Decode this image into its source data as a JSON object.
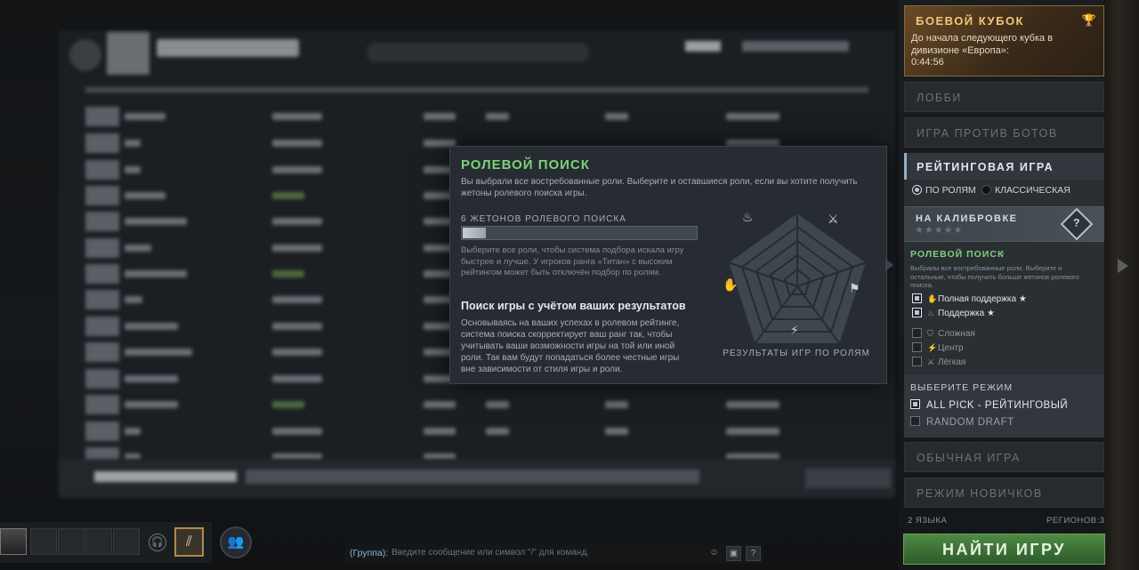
{
  "role_popup": {
    "title": "РОЛЕВОЙ ПОИСК",
    "description": "Вы выбрали все востребованные роли. Выберите и оставшиеся роли, если вы хотите получить жетоны ролевого поиска игры.",
    "tokens_label": "6 ЖЕТОНОВ РОЛЕВОГО ПОИСКА",
    "tokens_progress": 0.1,
    "tokens_note": "Выберите все роли, чтобы система подбора искала игру быстрее и лучше. У игроков ранга «Титан» с высоким рейтингом может быть отключён подбор по ролям.",
    "subtitle": "Поиск игры с учётом ваших результатов",
    "subtitle_desc": "Основываясь на ваших успехах в ролевом рейтинге, система поиска скорректирует ваш ранг так, чтобы учитывать ваши возможности игры на той или иной роли. Так вам будут попадаться более честные игры вне зависимости от стиля игры и роли.",
    "radar_label": "РЕЗУЛЬТАТЫ ИГР ПО РОЛЯМ"
  },
  "sidebar": {
    "battle_cup": {
      "title": "БОЕВОЙ КУБОК",
      "text": "До начала следующего кубка в дивизионе «Европа»:",
      "timer": "0:44:56",
      "icon": "trophy-icon"
    },
    "menu": {
      "lobby": "ЛОББИ",
      "bots": "ИГРА ПРОТИВ БОТОВ",
      "ranked": "РЕЙТИНГОВАЯ ИГРА",
      "normal": "ОБЫЧНАЯ ИГРА",
      "newbie": "РЕЖИМ НОВИЧКОВ"
    },
    "queue_types": {
      "by_roles": "ПО РОЛЯМ",
      "classic": "КЛАССИЧЕСКАЯ"
    },
    "calibration": {
      "title": "НА КАЛИБРОВКЕ",
      "stars": "★★★★★",
      "badge": "?"
    },
    "role_search": {
      "title": "РОЛЕВОЙ ПОИСК",
      "info": "i",
      "desc": "Выбраны все востребованные роли. Выберите и остальные, чтобы получить больше жетонов ролевого поиска."
    },
    "roles": [
      {
        "label": "Полная поддержка",
        "star": "★",
        "checked": true,
        "icon": "hard-support-icon"
      },
      {
        "label": "Поддержка",
        "star": "★",
        "checked": true,
        "icon": "soft-support-icon"
      },
      {
        "label": "Сложная",
        "checked": false,
        "icon": "offlane-icon"
      },
      {
        "label": "Центр",
        "checked": false,
        "icon": "mid-icon"
      },
      {
        "label": "Лёгкая",
        "checked": false,
        "icon": "carry-icon"
      }
    ],
    "mode_select": {
      "title": "ВЫБЕРИТЕ РЕЖИМ",
      "all_pick": "ALL PICK - РЕЙТИНГОВЫЙ",
      "random_draft": "RANDOM DRAFT"
    },
    "languages": "2 ЯЗЫКА",
    "regions": "РЕГИОНОВ:3",
    "find_button": "НАЙТИ ИГРУ"
  },
  "chat": {
    "group_label": "(Группа):",
    "placeholder": "Введите сообщение или символ \"/\" для команд.",
    "help": "?"
  },
  "colors": {
    "accent_green": "#7fd17a",
    "find_button": "#3a6d35",
    "cup_gold": "#f0c878"
  }
}
